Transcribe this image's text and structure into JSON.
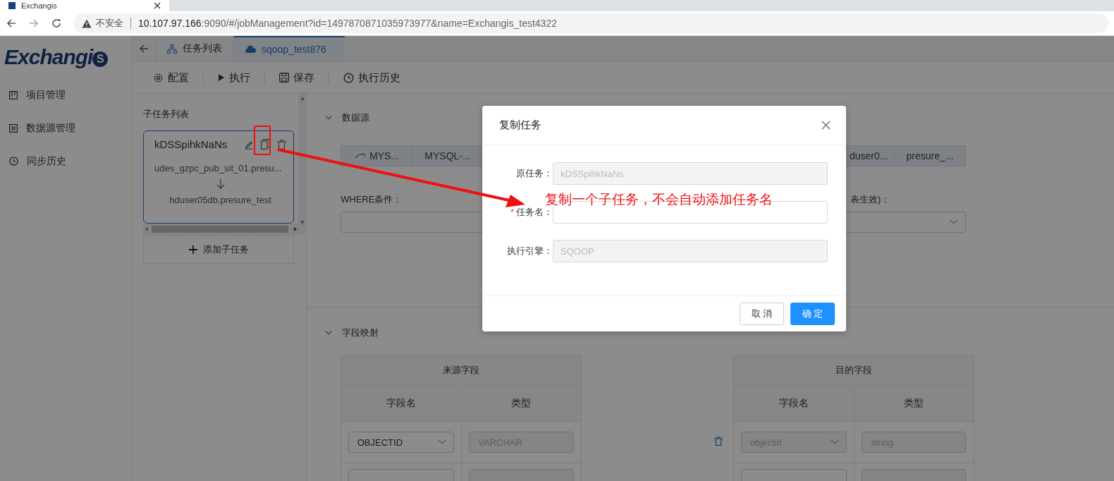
{
  "browser": {
    "tab_title": "Exchangis",
    "url_warning": "不安全",
    "url_host": "10.107.97.166",
    "url_rest": ":9090/#/jobManagement?id=1497870871035973977&name=Exchangis_test4322"
  },
  "sidebar": {
    "logo": "Exchangi",
    "logo_badge": "S",
    "items": [
      {
        "label": "项目管理",
        "selected": false
      },
      {
        "label": "数据源管理",
        "selected": false
      },
      {
        "label": "同步历史",
        "selected": false
      }
    ]
  },
  "tabs": [
    {
      "label": "任务列表",
      "selected": false
    },
    {
      "label": "sqoop_test876",
      "selected": true
    }
  ],
  "toolbar": [
    {
      "label": "配置"
    },
    {
      "label": "执行"
    },
    {
      "label": "保存"
    },
    {
      "label": "执行历史"
    }
  ],
  "subtasks": {
    "title": "子任务列表",
    "items": [
      {
        "name": "kDSSpihkNaNs",
        "source": "udes_gzpc_pub_sit_01.presu...",
        "target": "hduser05db.presure_test",
        "selected": true
      }
    ],
    "add_label": "添加子任务"
  },
  "data_source": {
    "title": "数据源",
    "expanded": true,
    "source_parts": [
      "MYS...",
      "MYSQL-..."
    ],
    "sink_parts": [
      "duser0...",
      "presure_..."
    ],
    "where_label": "WHERE条件：",
    "right_label": "表生效)："
  },
  "field_mapping": {
    "title": "字段映射",
    "expanded": true,
    "source_header": "来源字段",
    "target_header": "目的字段",
    "source_columns": [
      "字段名",
      "类型"
    ],
    "target_columns": [
      "字段名",
      "类型"
    ],
    "rows": [
      {
        "source_field": "OBJECTID",
        "source_type": "VARCHAR",
        "target_field": "objectid",
        "target_type": "string"
      }
    ]
  },
  "dialog": {
    "title": "复制任务",
    "required_mark": "*",
    "fields": [
      {
        "label": "原任务：",
        "value": "kDSSpihkNaNs",
        "required": false,
        "disabled": true
      },
      {
        "label": "任务名：",
        "required": true,
        "disabled": false
      },
      {
        "label": "执行引擎：",
        "value": "SQOOP",
        "required": false,
        "disabled": true
      }
    ],
    "cancel": "取 消",
    "ok": "确 定"
  },
  "annotation": {
    "text": "复制一个子任务，不会自动添加任务名"
  }
}
